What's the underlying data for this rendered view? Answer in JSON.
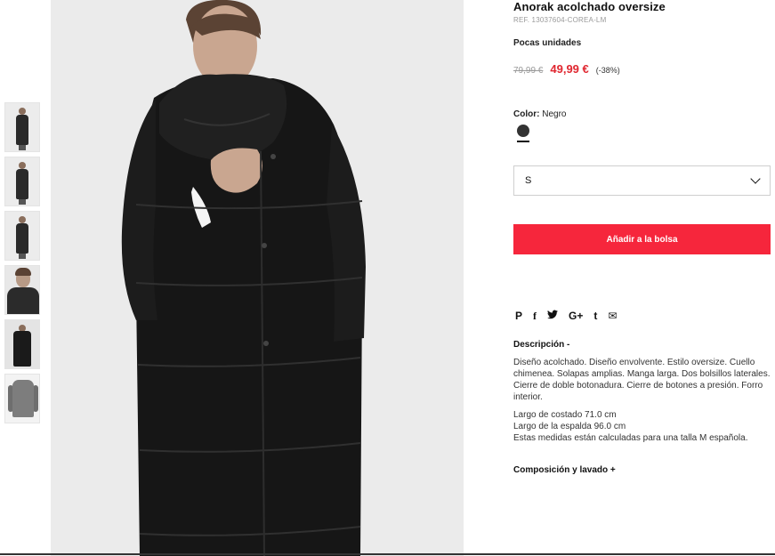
{
  "product": {
    "title": "Anorak acolchado oversize",
    "ref": "REF. 13037604-COREA-LM",
    "stock": "Pocas unidades",
    "old_price": "79,99 €",
    "new_price": "49,99 €",
    "discount": "(-38%)"
  },
  "color": {
    "label": "Color:",
    "value": "Negro",
    "swatch_hex": "#333333"
  },
  "size": {
    "selected": "S"
  },
  "cart": {
    "add_label": "Añadir a la bolsa",
    "button_color": "#f6263c"
  },
  "share": {
    "pinterest": "P",
    "facebook": "f",
    "google": "G+",
    "tumblr": "t",
    "email": "✉",
    "twitter": "🐦"
  },
  "description": {
    "title": "Descripción -",
    "text": "Diseño acolchado. Diseño envolvente. Estilo oversize. Cuello chimenea. Solapas amplias. Manga larga. Dos bolsillos laterales. Cierre de doble botonadura. Cierre de botones a presión. Forro interior.",
    "measures": [
      "Largo de costado 71.0 cm",
      "Largo de la espalda 96.0 cm",
      "Estas medidas están calculadas para una talla M española."
    ]
  },
  "composition": {
    "title": "Composición y lavado +"
  },
  "icons": {
    "select_chevron": "chevron-down-icon"
  },
  "colors": {
    "sale_price": "#e0262f",
    "background": "#ffffff"
  }
}
